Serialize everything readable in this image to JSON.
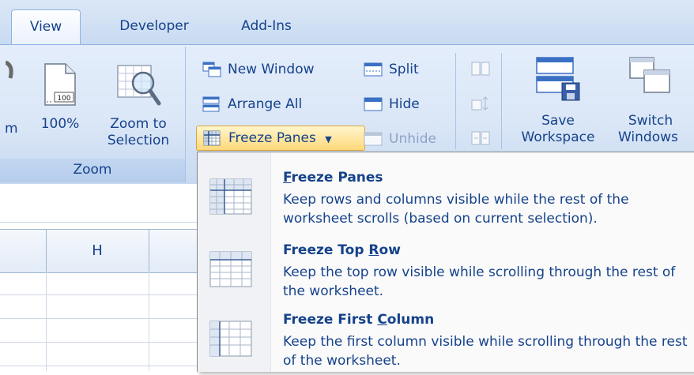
{
  "tabs": [
    {
      "label": "View",
      "active": true
    },
    {
      "label": "Developer",
      "active": false
    },
    {
      "label": "Add-Ins",
      "active": false
    }
  ],
  "zoom_group": {
    "partial_label": "m",
    "btn_100": {
      "label": "100%",
      "icon_text": "100"
    },
    "zoom_to_selection": {
      "line1": "Zoom to",
      "line2": "Selection"
    },
    "group_label": "Zoom"
  },
  "window_group": {
    "new_window": "New Window",
    "arrange_all": "Arrange All",
    "freeze_panes": "Freeze Panes",
    "split": "Split",
    "hide": "Hide",
    "unhide": "Unhide",
    "save_workspace": {
      "line1": "Save",
      "line2": "Workspace"
    },
    "switch_windows": {
      "line1": "Switch",
      "line2": "Windows"
    }
  },
  "sheet": {
    "column_header": "H"
  },
  "freeze_menu": {
    "items": [
      {
        "title_pre": "",
        "title_key": "F",
        "title_post": "reeze Panes",
        "desc": "Keep rows and columns visible while the rest of the worksheet scrolls (based on current selection)."
      },
      {
        "title_pre": "Freeze Top ",
        "title_key": "R",
        "title_post": "ow",
        "desc": "Keep the top row visible while scrolling through the rest of the worksheet."
      },
      {
        "title_pre": "Freeze First ",
        "title_key": "C",
        "title_post": "olumn",
        "desc": "Keep the first column visible while scrolling through the rest of the worksheet."
      }
    ]
  },
  "colors": {
    "text": "#15428b",
    "highlight": "#ffd97a",
    "ribbon": "#dbe7f7"
  }
}
